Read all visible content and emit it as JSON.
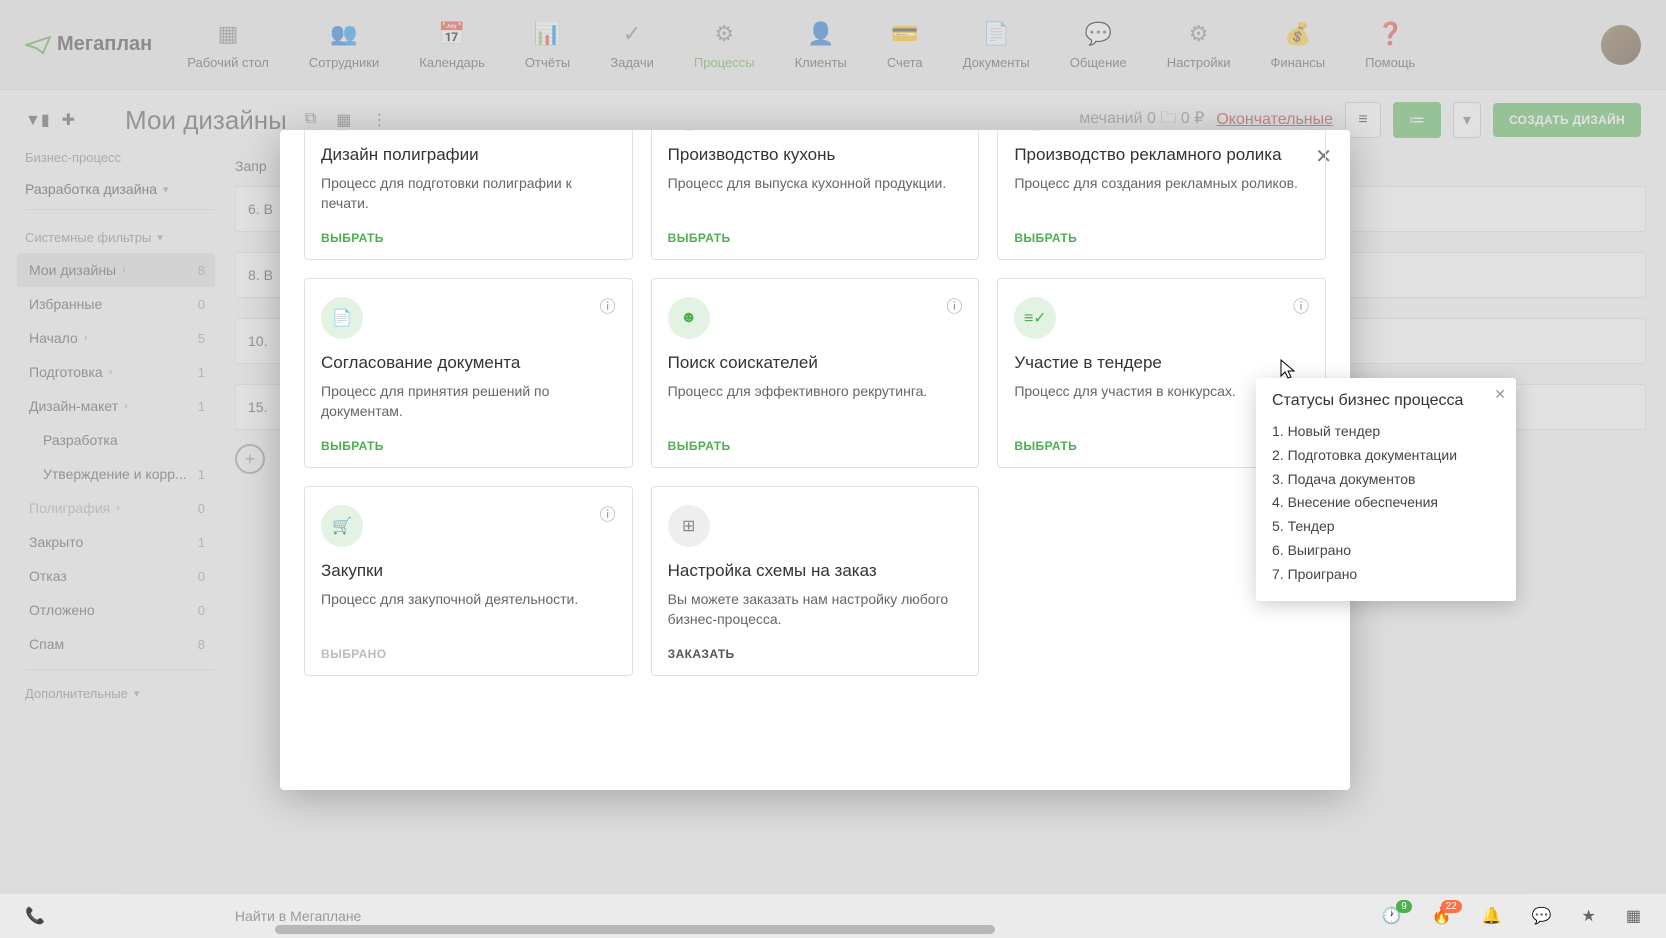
{
  "brand": "Мегаплан",
  "nav": [
    {
      "label": "Рабочий стол"
    },
    {
      "label": "Сотрудники"
    },
    {
      "label": "Календарь"
    },
    {
      "label": "Отчёты"
    },
    {
      "label": "Задачи"
    },
    {
      "label": "Процессы"
    },
    {
      "label": "Клиенты"
    },
    {
      "label": "Счета"
    },
    {
      "label": "Документы"
    },
    {
      "label": "Общение"
    },
    {
      "label": "Настройки"
    },
    {
      "label": "Финансы"
    },
    {
      "label": "Помощь"
    }
  ],
  "page_title": "Мои дизайны",
  "create_button": "СОЗДАТЬ ДИЗАЙН",
  "sidebar": {
    "process_label": "Бизнес-процесс",
    "process_value": "Разработка дизайна",
    "system_filters": "Системные фильтры",
    "additional": "Дополнительные",
    "filters": [
      {
        "name": "Мои дизайны",
        "count": "8",
        "active": true,
        "chevron": true
      },
      {
        "name": "Избранные",
        "count": "0"
      },
      {
        "name": "Начало",
        "count": "5",
        "chevron": true
      },
      {
        "name": "Подготовка",
        "count": "1",
        "chevron": true
      },
      {
        "name": "Дизайн-макет",
        "count": "1",
        "chevron": true
      },
      {
        "name": "Разработка",
        "count": "",
        "indent": true
      },
      {
        "name": "Утверждение и корр...",
        "count": "1",
        "indent": true
      },
      {
        "name": "Полиграфия",
        "count": "0",
        "chevron": true,
        "muted": true
      },
      {
        "name": "Закрыто",
        "count": "1"
      },
      {
        "name": "Отказ",
        "count": "0"
      },
      {
        "name": "Отложено",
        "count": "0"
      },
      {
        "name": "Спам",
        "count": "8"
      }
    ]
  },
  "tabs": {
    "first": "Запр",
    "notes_label": "мечаний",
    "notes_count": "0",
    "money": "0 ₽",
    "final": "Окончательные"
  },
  "rows": [
    "6. В",
    "8. В",
    "10. ",
    "15. "
  ],
  "modal": {
    "cards": [
      {
        "title": "Дизайн полиграфии",
        "desc": "Процесс для подготовки полиграфии к печати.",
        "action": "ВЫБРАТЬ",
        "icon": "green"
      },
      {
        "title": "Производство кухонь",
        "desc": "Процесс для выпуска кухонной продукции.",
        "action": "ВЫБРАТЬ",
        "icon": "green"
      },
      {
        "title": "Производство рекламного ролика",
        "desc": "Процесс для создания рекламных роликов.",
        "action": "ВЫБРАТЬ",
        "icon": "green"
      },
      {
        "title": "Согласование документа",
        "desc": "Процесс для принятия решений по документам.",
        "action": "ВЫБРАТЬ",
        "icon": "green",
        "info": true
      },
      {
        "title": "Поиск соискателей",
        "desc": "Процесс для эффективного рекрутинга.",
        "action": "ВЫБРАТЬ",
        "icon": "green",
        "info": true
      },
      {
        "title": "Участие в тендере",
        "desc": "Процесс для участия в конкурсах.",
        "action": "ВЫБРАТЬ",
        "icon": "green",
        "info": true
      },
      {
        "title": "Закупки",
        "desc": "Процесс для закупочной деятельности.",
        "action": "ВЫБРАНО",
        "action_class": "disabled",
        "icon": "green",
        "info": true
      },
      {
        "title": "Настройка схемы на заказ",
        "desc": "Вы можете заказать нам настройку любого бизнес-процесса.",
        "action": "ЗАКАЗАТЬ",
        "action_class": "order",
        "icon": "gray"
      }
    ]
  },
  "tooltip": {
    "title": "Статусы бизнес процесса",
    "items": [
      "1. Новый тендер",
      "2. Подготовка документации",
      "3. Подача документов",
      "4. Внесение обеспечения",
      "5. Тендер",
      "6. Выиграно",
      "7. Проиграно"
    ]
  },
  "footer": {
    "search_placeholder": "Найти в Мегаплане",
    "badge1": "9",
    "badge2": "22"
  }
}
